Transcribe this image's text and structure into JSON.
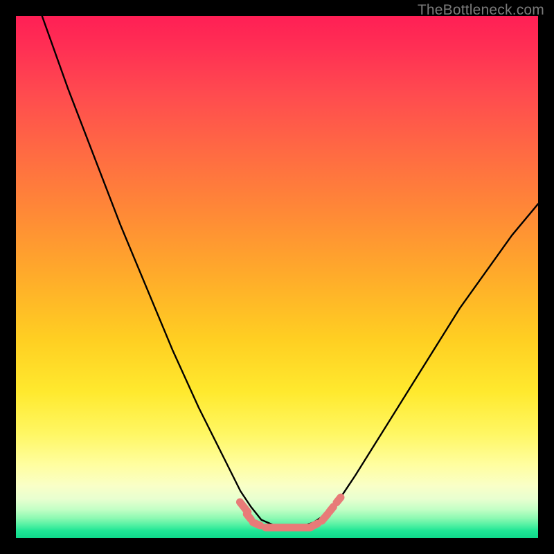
{
  "watermark": "TheBottleneck.com",
  "chart_data": {
    "type": "line",
    "title": "",
    "xlabel": "",
    "ylabel": "",
    "xlim": [
      0,
      100
    ],
    "ylim": [
      0,
      100
    ],
    "grid": false,
    "legend": false,
    "series": [
      {
        "name": "curve",
        "color": "#000000",
        "x": [
          5,
          10,
          15,
          20,
          25,
          30,
          35,
          40,
          43,
          45,
          47,
          50,
          53,
          55,
          57,
          60,
          62,
          65,
          70,
          75,
          80,
          85,
          90,
          95,
          100
        ],
        "y": [
          100,
          86,
          73,
          60,
          48,
          36,
          25,
          15,
          9,
          6,
          3.5,
          2.2,
          2,
          2.3,
          3,
          5,
          7.5,
          12,
          20,
          28,
          36,
          44,
          51,
          58,
          64
        ]
      }
    ],
    "markers": {
      "name": "marker-band",
      "color": "#e87b78",
      "segments": [
        {
          "x0": 42.9,
          "y0": 6.9,
          "x1": 44.4,
          "y1": 5.0
        },
        {
          "x0": 44.2,
          "y0": 4.6,
          "x1": 45.0,
          "y1": 3.6
        },
        {
          "x0": 45.4,
          "y0": 3.0,
          "x1": 46.8,
          "y1": 2.4
        },
        {
          "x0": 47.8,
          "y0": 2.0,
          "x1": 56.4,
          "y1": 2.0
        },
        {
          "x0": 56.6,
          "y0": 2.2,
          "x1": 57.8,
          "y1": 2.8
        },
        {
          "x0": 58.6,
          "y0": 3.3,
          "x1": 59.7,
          "y1": 4.6
        },
        {
          "x0": 60.0,
          "y0": 5.0,
          "x1": 60.8,
          "y1": 6.0
        },
        {
          "x0": 61.4,
          "y0": 6.8,
          "x1": 62.2,
          "y1": 7.8
        }
      ]
    },
    "background_gradient": {
      "stops": [
        {
          "pos": 0.0,
          "color": "#ff1f55"
        },
        {
          "pos": 0.5,
          "color": "#ffac2a"
        },
        {
          "pos": 0.8,
          "color": "#fff763"
        },
        {
          "pos": 0.92,
          "color": "#e8ffd0"
        },
        {
          "pos": 1.0,
          "color": "#0fd98b"
        }
      ]
    }
  }
}
